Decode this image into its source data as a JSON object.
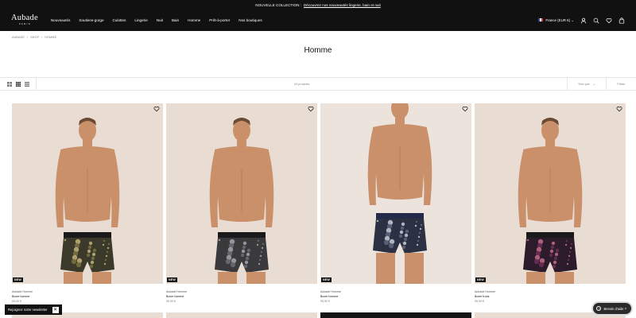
{
  "announcement": {
    "prefix": "NOUVELLE COLLECTION :",
    "link": "Découvrez nos nouveautés lingerie, bain et nuit"
  },
  "header": {
    "logo_word": "Aubade",
    "logo_sub": "PARIS",
    "nav": [
      "Nouveautés",
      "Soutiens-gorge",
      "Culottes",
      "Lingerie",
      "Nuit",
      "Bain",
      "Homme",
      "Prêt-à-porter",
      "Nos boutiques"
    ],
    "locale": "France (EUR €)",
    "icons": [
      "account-icon",
      "search-icon",
      "wishlist-icon",
      "cart-icon"
    ]
  },
  "breadcrumb": [
    "AUBADE",
    "SHOP",
    "HOMME"
  ],
  "page": {
    "title": "Homme"
  },
  "toolbar": {
    "count": "44 produits",
    "sort_label": "Trier par",
    "filter_label": "Filtrer"
  },
  "products": [
    {
      "brand": "Aubade Homme",
      "name": "Boxer homme",
      "price": "69,00 €",
      "badge": "NEW",
      "pattern": "olive-paisley"
    },
    {
      "brand": "Aubade Homme",
      "name": "Boxer homme",
      "price": "59,00 €",
      "badge": "NEW",
      "pattern": "grey-print"
    },
    {
      "brand": "Aubade Homme",
      "name": "Boxer homme",
      "price": "59,00 €",
      "badge": "NEW",
      "pattern": "navy-paisley"
    },
    {
      "brand": "Aubade Homme",
      "name": "Boxer trunk",
      "price": "59,00 €",
      "badge": "NEW",
      "pattern": "plum-paisley"
    }
  ],
  "newsletter": {
    "label": "Rejoignez notre newsletter",
    "close": "✕"
  },
  "help": {
    "label": "Besoin d'aide ?",
    "icon": "question-icon"
  },
  "colors": {
    "header_bg": "#111111",
    "photo_bg": "#e9dcd3",
    "skin": "#c9906a"
  }
}
